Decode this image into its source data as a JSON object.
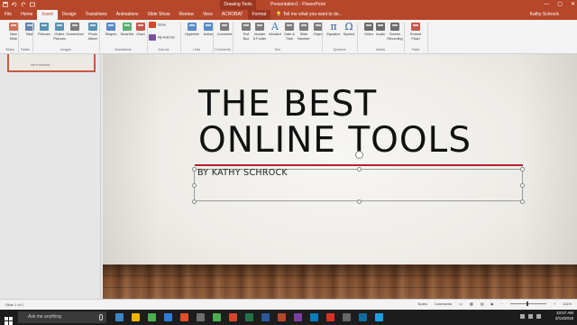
{
  "window": {
    "contextual_header": "Drawing Tools",
    "title": "Presentation1 - PowerPoint",
    "controls": [
      "—",
      "▢",
      "✕"
    ]
  },
  "tabs": [
    {
      "label": "File"
    },
    {
      "label": "Home"
    },
    {
      "label": "Insert",
      "active": true
    },
    {
      "label": "Design"
    },
    {
      "label": "Transitions"
    },
    {
      "label": "Animations"
    },
    {
      "label": "Slide Show"
    },
    {
      "label": "Review"
    },
    {
      "label": "View"
    },
    {
      "label": "ACROBAT"
    },
    {
      "label": "Format",
      "contextual": true
    }
  ],
  "tell_me": "Tell me what you want to do...",
  "user": "Kathy Schrock",
  "ribbon": {
    "buttons": [
      {
        "id": "new-slide",
        "label": "New\nSlide",
        "color": "#c55a40"
      },
      {
        "id": "table",
        "label": "Table",
        "color": "#4a6fa5"
      },
      {
        "id": "pictures",
        "label": "Pictures",
        "color": "#3b82a6"
      },
      {
        "id": "online-pictures",
        "label": "Online\nPictures",
        "color": "#3b82a6"
      },
      {
        "id": "screenshot",
        "label": "Screenshot",
        "color": "#666666"
      },
      {
        "id": "photo-album",
        "label": "Photo\nAlbum",
        "color": "#3b82a6"
      },
      {
        "id": "shapes",
        "label": "Shapes",
        "color": "#3b78c0"
      },
      {
        "id": "smartart",
        "label": "SmartArt",
        "color": "#3aa55a"
      },
      {
        "id": "chart",
        "label": "Chart",
        "color": "#c0392b"
      },
      {
        "id": "store",
        "label": "Store",
        "color": "#d24726"
      },
      {
        "id": "my-addins",
        "label": "My Add-ins",
        "color": "#7a4fa0"
      },
      {
        "id": "hyperlink",
        "label": "Hyperlink",
        "color": "#3b78c0"
      },
      {
        "id": "action",
        "label": "Action",
        "color": "#3b78c0"
      },
      {
        "id": "comment",
        "label": "Comment",
        "color": "#666666"
      },
      {
        "id": "text-box",
        "label": "Text\nBox",
        "color": "#666666"
      },
      {
        "id": "header-footer",
        "label": "Header\n& Footer",
        "color": "#666666"
      },
      {
        "id": "wordart",
        "label": "WordArt",
        "color": "#3b78c0"
      },
      {
        "id": "date-time",
        "label": "Date &\nTime",
        "color": "#666666"
      },
      {
        "id": "slide-number",
        "label": "Slide\nNumber",
        "color": "#666666"
      },
      {
        "id": "object",
        "label": "Object",
        "color": "#666666"
      },
      {
        "id": "equation",
        "label": "Equation",
        "color": "#2e5b9a"
      },
      {
        "id": "symbol",
        "label": "Symbol",
        "color": "#2e5b9a"
      },
      {
        "id": "video",
        "label": "Video",
        "color": "#555555"
      },
      {
        "id": "audio",
        "label": "Audio",
        "color": "#555555"
      },
      {
        "id": "screen-recording",
        "label": "Screen\nRecording",
        "color": "#555555"
      },
      {
        "id": "embed-flash",
        "label": "Embed\nFlash",
        "color": "#c0392b"
      }
    ],
    "groups": [
      "Slides",
      "Tables",
      "Images",
      "Illustrations",
      "Add-ins",
      "Links",
      "Comments",
      "Text",
      "Symbols",
      "Media",
      "Flash"
    ],
    "symbol_glyphs": {
      "equation": "π",
      "symbol": "Ω",
      "wordart": "A"
    }
  },
  "slide": {
    "title": "THE BEST ONLINE TOOLS",
    "subtitle": "BY KATHY SCHROCK",
    "accent_color": "#b0232a"
  },
  "thumbnail": {
    "subtitle": "KATHY SCHROCK"
  },
  "status": {
    "slide_of": "Slide 1 of 1",
    "notes": "Notes",
    "comments": "Comments",
    "zoom": "111%"
  },
  "taskbar": {
    "search_placeholder": "Ask me anything",
    "time": "10:07 AM",
    "date": "2/13/2016",
    "apps": [
      "#3d86c6",
      "#f0b400",
      "#4caf50",
      "#2f7bd8",
      "#e44d26",
      "#6d6d6d",
      "#4caf50",
      "#d24726",
      "#217346",
      "#2b579a",
      "#b7472a",
      "#7a3e9d",
      "#0a7bbd",
      "#d93025",
      "#666666",
      "#0e6e9e",
      "#1ba1e2"
    ]
  }
}
